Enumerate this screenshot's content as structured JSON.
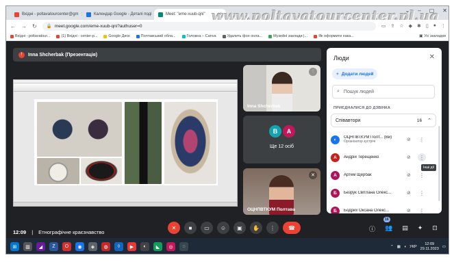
{
  "watermark": "www.poltavatourcenter.pl.ua",
  "tabs": [
    {
      "label": "Вхідні - poltavatourcenter@gm",
      "color": "#ea4335"
    },
    {
      "label": "Календар Google - Деталі поді",
      "color": "#1a73e8"
    },
    {
      "label": "Meet: \"eme-xuub-qni\"",
      "color": "#00897b"
    }
  ],
  "address": {
    "url": "meet.google.com/eme-xuub-qni?authuser=0"
  },
  "bookmarks": [
    {
      "label": "Вхідні - poltavatour...",
      "color": "#ea4335"
    },
    {
      "label": "(1) Вхідні - center-p...",
      "color": "#ea4335"
    },
    {
      "label": "Google Диск",
      "color": "#fbbc04"
    },
    {
      "label": "Полтавський обла...",
      "color": "#1a73e8"
    },
    {
      "label": "Головна – Canva",
      "color": "#00c4cc"
    },
    {
      "label": "Удалить фон онла...",
      "color": "#5f6368"
    },
    {
      "label": "Музейні заклади |...",
      "color": "#34a853"
    },
    {
      "label": "Як оформити нака...",
      "color": "#ea4335"
    }
  ],
  "bookmarks_right": "Усі закладки",
  "presenter": "Inna Shcherbak (Презентація)",
  "tiles": {
    "top_name": "Inna Shcherbak",
    "group_avatars": [
      "В",
      "А"
    ],
    "group_label": "Ще 12 осіб",
    "bottom_name": "ОЦНПВТКУМ Полтава"
  },
  "bottom": {
    "time": "12:09",
    "separator": "|",
    "meeting": "Етнографічне краєзнавство",
    "people_count": "16"
  },
  "panel": {
    "title": "Люди",
    "add_people": "Додати людей",
    "search_placeholder": "Пошук людей",
    "joined_label": "ПРИЄДНАЛИСЯ ДО ДЗВІНКА",
    "group": {
      "label": "Співавтори",
      "count": "16"
    },
    "tooltip": "Інші дії",
    "people": [
      {
        "avatar": "",
        "name": "ОЦНПВТКУМ Полт... (Ви)",
        "role": "Організатор зустрічі",
        "color": "#1a73e8"
      },
      {
        "avatar": "А",
        "name": "Андрій Терещенко",
        "role": "",
        "color": "#c5221f"
      },
      {
        "avatar": "А",
        "name": "Артем Щербак",
        "role": "",
        "color": "#ad1457"
      },
      {
        "avatar": "Б",
        "name": "Безрук Світлана Олекс...",
        "role": "",
        "color": "#ad1457"
      },
      {
        "avatar": "Б",
        "name": "Бодрих Оксана Олекс...",
        "role": "",
        "color": "#ad1457"
      }
    ]
  },
  "tray": {
    "lang": "УКР",
    "time": "12:09",
    "date": "29.11.2023"
  },
  "colors": {
    "meet_bg": "#202124",
    "end_call": "#ea4335",
    "accent": "#1a73e8"
  }
}
